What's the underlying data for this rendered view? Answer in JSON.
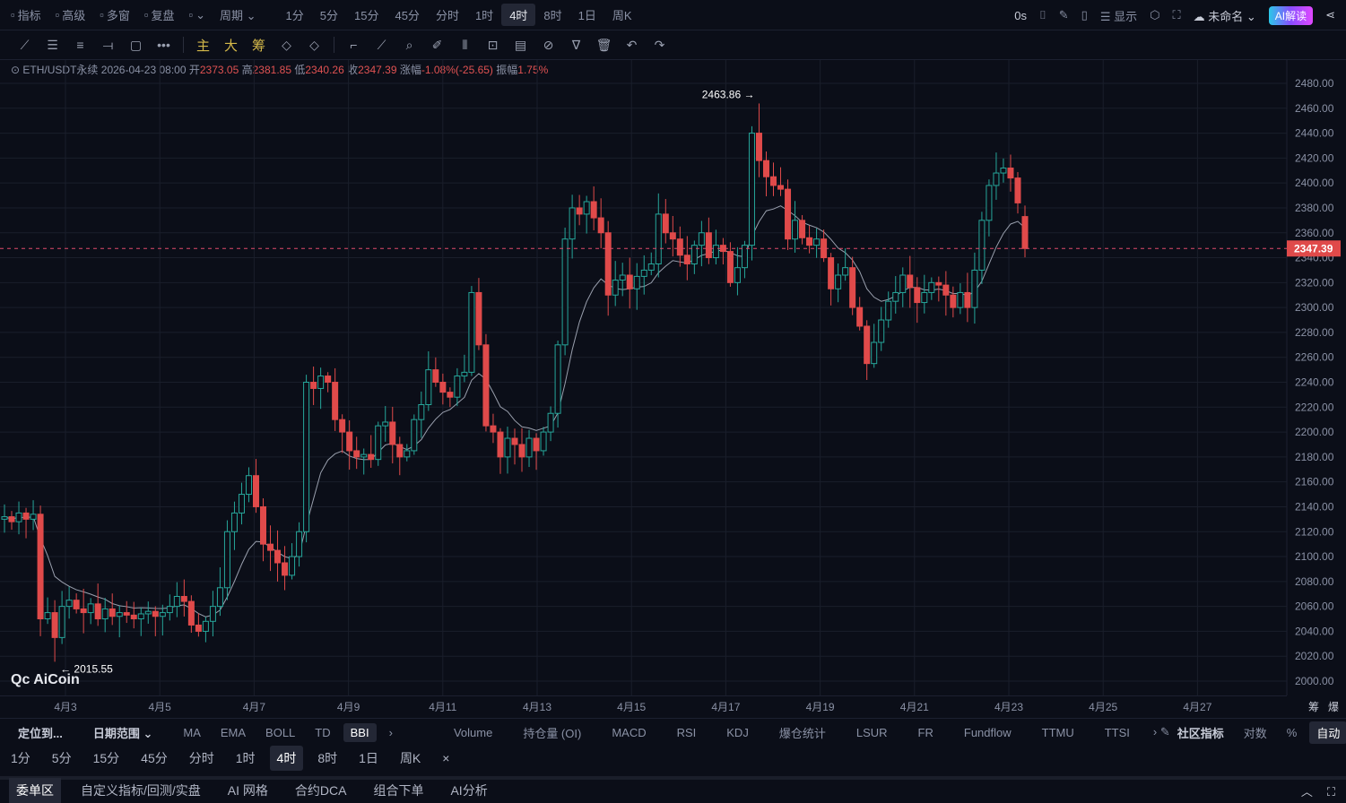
{
  "top": {
    "left": [
      {
        "icon": "chart-line-icon",
        "label": "指标"
      },
      {
        "icon": "window-icon",
        "label": "高级"
      },
      {
        "icon": "grid-icon",
        "label": "多窗"
      },
      {
        "icon": "rewind-icon",
        "label": "复盘"
      },
      {
        "icon": "candle-type-icon",
        "label": "⌄"
      },
      {
        "icon": "",
        "label": "周期 ⌄"
      }
    ],
    "periods": [
      "1分",
      "5分",
      "15分",
      "45分",
      "分时",
      "1时",
      "4时",
      "8时",
      "1日",
      "周K"
    ],
    "active_period": "4时",
    "right": {
      "countdown": "0s",
      "display": "显示",
      "layout_name": "未命名",
      "ai": "AI解读"
    }
  },
  "tools": {
    "draw": [
      "⟋",
      "☰",
      "≡",
      "⟞",
      "▢",
      "•••"
    ],
    "overlay": [
      "主",
      "大",
      "筹"
    ]
  },
  "info": {
    "symbol": "ETH/USDT永续",
    "time": "2026-04-23 08:00",
    "open_label": "开",
    "open": "2373.05",
    "high_label": "高",
    "high": "2381.85",
    "low_label": "低",
    "low": "2340.26",
    "close_label": "收",
    "close": "2347.39",
    "change_label": "涨幅",
    "change": "-1.08%(-25.65)",
    "amp_label": "振幅",
    "amp": "1.75%"
  },
  "colors": {
    "up": "#26a69a",
    "down": "#e04a4a",
    "bbi": "#9aa0ae",
    "bg": "#0b0e18"
  },
  "chart_data": {
    "type": "candlestick",
    "indicator": "BBI",
    "ylim": [
      2000,
      2480
    ],
    "yticks": [
      2480,
      2460,
      2440,
      2420,
      2400,
      2380,
      2360,
      2340,
      2320,
      2300,
      2280,
      2260,
      2240,
      2220,
      2200,
      2180,
      2160,
      2140,
      2120,
      2100,
      2080,
      2060,
      2040,
      2020,
      2000
    ],
    "ytick_labels": [
      "2480.00",
      "2460.00",
      "2440.00",
      "2420.00",
      "2400.00",
      "2380.00",
      "2360.00",
      "2340.00",
      "2320.00",
      "2300.00",
      "2280.00",
      "2260.00",
      "2240.00",
      "2220.00",
      "2200.00",
      "2180.00",
      "2160.00",
      "2140.00",
      "2120.00",
      "2100.00",
      "2080.00",
      "2060.00",
      "2040.00",
      "2020.00",
      "2000.00"
    ],
    "xtick_labels": [
      "4月3",
      "4月5",
      "4月7",
      "4月9",
      "4月11",
      "4月13",
      "4月15",
      "4月17",
      "4月19",
      "4月21",
      "4月23",
      "4月25",
      "4月27"
    ],
    "first_open": 2130,
    "closes": [
      2132,
      2128,
      2135,
      2130,
      2134,
      2050,
      2055,
      2035,
      2060,
      2065,
      2058,
      2055,
      2062,
      2050,
      2058,
      2052,
      2055,
      2053,
      2050,
      2054,
      2056,
      2052,
      2055,
      2060,
      2068,
      2064,
      2045,
      2040,
      2048,
      2060,
      2075,
      2120,
      2135,
      2150,
      2165,
      2140,
      2110,
      2105,
      2095,
      2085,
      2100,
      2120,
      2240,
      2235,
      2245,
      2240,
      2210,
      2200,
      2185,
      2180,
      2182,
      2178,
      2205,
      2208,
      2190,
      2180,
      2185,
      2210,
      2222,
      2250,
      2240,
      2232,
      2228,
      2245,
      2248,
      2312,
      2270,
      2205,
      2200,
      2180,
      2195,
      2190,
      2180,
      2195,
      2185,
      2200,
      2215,
      2270,
      2355,
      2380,
      2375,
      2385,
      2372,
      2360,
      2310,
      2322,
      2326,
      2315,
      2325,
      2330,
      2335,
      2375,
      2360,
      2355,
      2342,
      2335,
      2350,
      2360,
      2340,
      2350,
      2345,
      2320,
      2332,
      2350,
      2440,
      2418,
      2405,
      2398,
      2395,
      2355,
      2370,
      2356,
      2350,
      2355,
      2340,
      2315,
      2326,
      2332,
      2300,
      2285,
      2255,
      2272,
      2290,
      2305,
      2312,
      2326,
      2316,
      2304,
      2312,
      2320,
      2318,
      2310,
      2300,
      2312,
      2300,
      2330,
      2370,
      2398,
      2408,
      2412,
      2404,
      2384,
      2347.39
    ],
    "last": {
      "open": 2373.05,
      "high": 2381.85,
      "low": 2340.26,
      "close": 2347.39
    },
    "max_label": "2463.86",
    "min_label": "2015.55",
    "last_label": "2347.39"
  },
  "axis_right": [
    "筹",
    "爆"
  ],
  "indicators": {
    "locate": "定位到...",
    "range": "日期范围 ⌄",
    "main": [
      "MA",
      "EMA",
      "BOLL",
      "TD",
      "BBI"
    ],
    "active": "BBI",
    "sub": [
      "Volume",
      "持仓量 (OI)",
      "MACD",
      "RSI",
      "KDJ",
      "爆仓统计",
      "LSUR",
      "FR",
      "Fundflow",
      "TTMU",
      "TTSI"
    ],
    "community": "社区指标",
    "log": "对数",
    "pct": "%",
    "auto": "自动"
  },
  "periods2": [
    "1分",
    "5分",
    "15分",
    "45分",
    "分时",
    "1时",
    "4时",
    "8时",
    "1日",
    "周K"
  ],
  "bottom": [
    "委单区",
    "自定义指标/回测/实盘",
    "AI 网格",
    "合约DCA",
    "组合下单",
    "AI分析"
  ],
  "logo": "AiCoin"
}
